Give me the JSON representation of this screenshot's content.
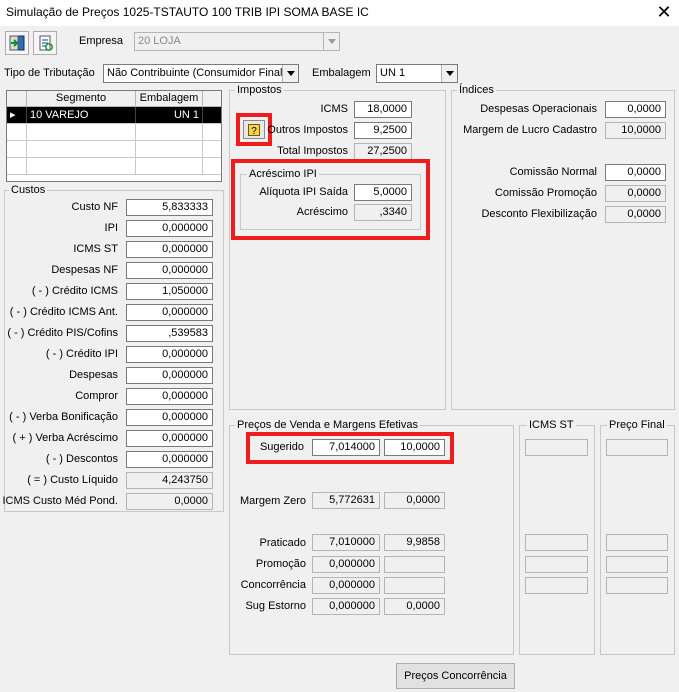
{
  "window": {
    "title": "Simulação de Preços  1025-TSTAUTO 100 TRIB IPI SOMA BASE IC",
    "close_glyph": "✕"
  },
  "toolbar": {
    "exit_icon": "exit-door-icon",
    "refresh_icon": "refresh-doc-icon"
  },
  "empresa": {
    "label": "Empresa",
    "value": "20 LOJA"
  },
  "tributacao": {
    "label": "Tipo de Tributação",
    "value": "Não Contribuinte (Consumidor Final)"
  },
  "embalagem": {
    "label": "Embalagem",
    "value": "UN  1"
  },
  "segment_grid": {
    "headers": [
      "Segmento",
      "Embalagem"
    ],
    "rows": [
      {
        "segmento": "10 VAREJO",
        "embalagem": "UN  1"
      }
    ]
  },
  "custos": {
    "title": "Custos",
    "rows": [
      {
        "label": "Custo NF",
        "value": "5,833333"
      },
      {
        "label": "IPI",
        "value": "0,000000"
      },
      {
        "label": "ICMS ST",
        "value": "0,000000"
      },
      {
        "label": "Despesas NF",
        "value": "0,000000"
      },
      {
        "label": "( - ) Crédito ICMS",
        "value": "1,050000"
      },
      {
        "label": "( - ) Crédito ICMS Ant.",
        "value": "0,000000"
      },
      {
        "label": "( - ) Crédito PIS/Cofins",
        "value": ",539583"
      },
      {
        "label": "( - ) Crédito IPI",
        "value": "0,000000"
      },
      {
        "label": "Despesas",
        "value": "0,000000"
      },
      {
        "label": "Compror",
        "value": "0,000000"
      },
      {
        "label": "( - ) Verba Bonificação",
        "value": "0,000000"
      },
      {
        "label": "( + ) Verba Acréscimo",
        "value": "0,000000"
      },
      {
        "label": "( - ) Descontos",
        "value": "0,000000"
      },
      {
        "label": "( = ) Custo Líquido",
        "value": "4,243750"
      }
    ],
    "icms_medio": {
      "label": "ICMS Custo Méd Pond.",
      "value": "0,0000"
    }
  },
  "impostos": {
    "title": "Impostos",
    "icms": {
      "label": "ICMS",
      "value": "18,0000"
    },
    "outros": {
      "label": "Outros Impostos",
      "value": "9,2500"
    },
    "total": {
      "label": "Total Impostos",
      "value": "27,2500"
    },
    "help_icon": "help-book-icon"
  },
  "acrescimo_ipi": {
    "title": "Acréscimo IPI",
    "aliquota": {
      "label": "Alíquota IPI Saída",
      "value": "5,0000"
    },
    "acrescimo": {
      "label": "Acréscimo",
      "value": ",3340"
    }
  },
  "indices": {
    "title": "Índices",
    "rows": [
      {
        "label": "Despesas Operacionais",
        "value": "0,0000"
      },
      {
        "label": "Margem de Lucro Cadastro",
        "value": "10,0000"
      },
      {
        "label": "Comissão Normal",
        "value": "0,0000"
      },
      {
        "label": "Comissão Promoção",
        "value": "0,0000"
      },
      {
        "label": "Desconto Flexibilização",
        "value": "0,0000"
      }
    ]
  },
  "precos": {
    "title": "Preços de Venda e Margens Efetivas",
    "sugerido": {
      "label": "Sugerido",
      "price": "7,014000",
      "margin": "10,0000"
    },
    "margem_zero": {
      "label": "Margem Zero",
      "price": "5,772631",
      "margin": "0,0000"
    },
    "praticado": {
      "label": "Praticado",
      "price": "7,010000",
      "margin": "9,9858"
    },
    "promocao": {
      "label": "Promoção",
      "price": "0,000000",
      "margin": ""
    },
    "concorrencia": {
      "label": "Concorrência",
      "price": "0,000000",
      "margin": ""
    },
    "sug_estorno": {
      "label": "Sug Estorno",
      "price": "0,000000",
      "margin": "0,0000"
    }
  },
  "icms_st_group": {
    "title": "ICMS ST"
  },
  "preco_final_group": {
    "title": "Preço Final"
  },
  "buttons": {
    "precos_concorrencia": "Preços Concorrência"
  },
  "colors": {
    "highlight": "#ee1c1c",
    "selection": "#000000",
    "window_bg": "#f0f0f0"
  }
}
